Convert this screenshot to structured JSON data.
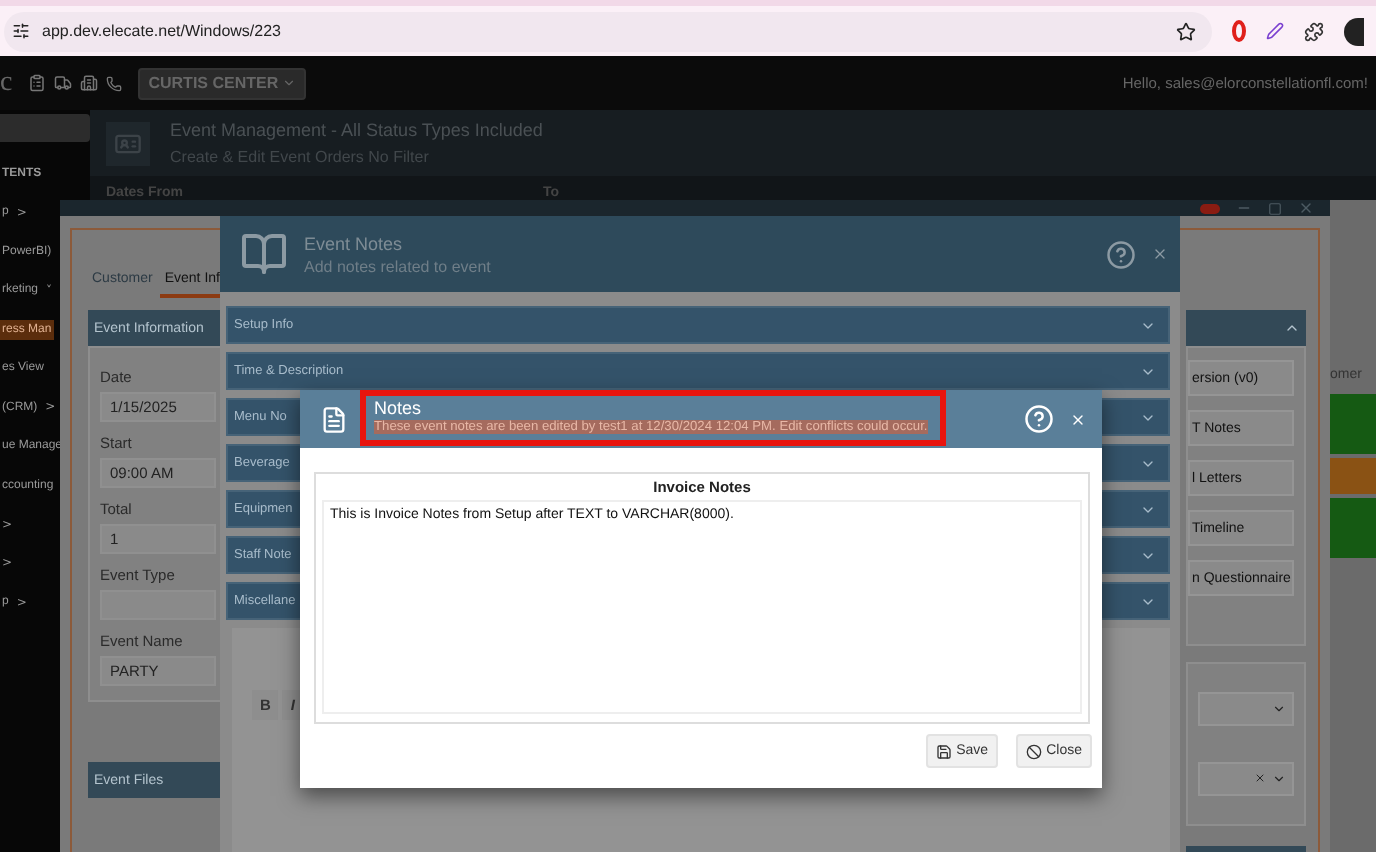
{
  "browser": {
    "url": "app.dev.elecate.net/Windows/223"
  },
  "header": {
    "logo": "c",
    "location": "CURTIS CENTER",
    "greeting": "Hello, sales@elorconstellationfl.com!"
  },
  "sidebar": {
    "items": [
      {
        "label": "TENTS",
        "kind": "heading"
      },
      {
        "label": "p",
        "kind": "menu",
        "chevron": ">",
        "selected": false
      },
      {
        "label": "PowerBI)",
        "kind": "menu",
        "selected": false
      },
      {
        "label": "rketing",
        "kind": "menu",
        "chevron": "˅",
        "selected": false
      },
      {
        "label": "ress Man",
        "kind": "menu",
        "selected": true
      },
      {
        "label": "es View",
        "kind": "menu",
        "selected": false
      },
      {
        "label": "(CRM)",
        "kind": "menu",
        "chevron": ">",
        "selected": false
      },
      {
        "label": "ue Manage",
        "kind": "menu",
        "selected": false
      },
      {
        "label": "ccounting",
        "kind": "menu",
        "selected": false
      },
      {
        "kind": "menu",
        "chevron": ">",
        "selected": false
      },
      {
        "kind": "menu",
        "chevron": ">",
        "selected": false
      },
      {
        "label": "p",
        "kind": "menu",
        "chevron": ">",
        "selected": false
      }
    ]
  },
  "page": {
    "title": "Event Management - All Status Types Included",
    "subtitle": "Create & Edit Event Orders No Filter",
    "filter_labels": [
      "Dates From",
      "To"
    ]
  },
  "event_window": {
    "tabs": [
      {
        "label": "Customer",
        "selected": false
      },
      {
        "label": "Event Inf",
        "selected": true
      }
    ],
    "panel_title": "Event Information",
    "fields": [
      {
        "label": "Date",
        "value": "1/15/2025"
      },
      {
        "label": "Start",
        "value": "09:00 AM"
      },
      {
        "label": "Total",
        "value": "1"
      },
      {
        "label": "Event Type"
      },
      {
        "label": "Event Name",
        "value": "PARTY"
      }
    ],
    "files_title": "Event Files",
    "side_buttons": [
      "ersion (v0)",
      "T Notes",
      "l Letters",
      "Timeline",
      "n Questionnaire"
    ],
    "side_tab": "omer"
  },
  "event_notes": {
    "title": "Event Notes",
    "subtitle": "Add notes related to event",
    "sections": [
      {
        "label": "Setup Info",
        "expanded": false
      },
      {
        "label": "Time & Description",
        "expanded": false
      },
      {
        "label": "Menu No",
        "expanded": false
      },
      {
        "label": "Beverage",
        "expanded": false
      },
      {
        "label": "Equipmen",
        "expanded": false
      },
      {
        "label": "Staff Note",
        "expanded": false
      },
      {
        "label": "Miscellane",
        "expanded": false
      }
    ],
    "toolbar": [
      "B",
      "I"
    ]
  },
  "notes_dialog": {
    "title": "Notes",
    "warning": "These event notes are been edited by test1 at 12/30/2024 12:04 PM. Edit conflicts could occur.",
    "highlighted": true,
    "card_title": "Invoice Notes",
    "text": "This is Invoice Notes from Setup after TEXT to VARCHAR(8000).",
    "buttons": [
      {
        "label": "Save",
        "kind": "save"
      },
      {
        "label": "Close",
        "kind": "close"
      }
    ]
  }
}
